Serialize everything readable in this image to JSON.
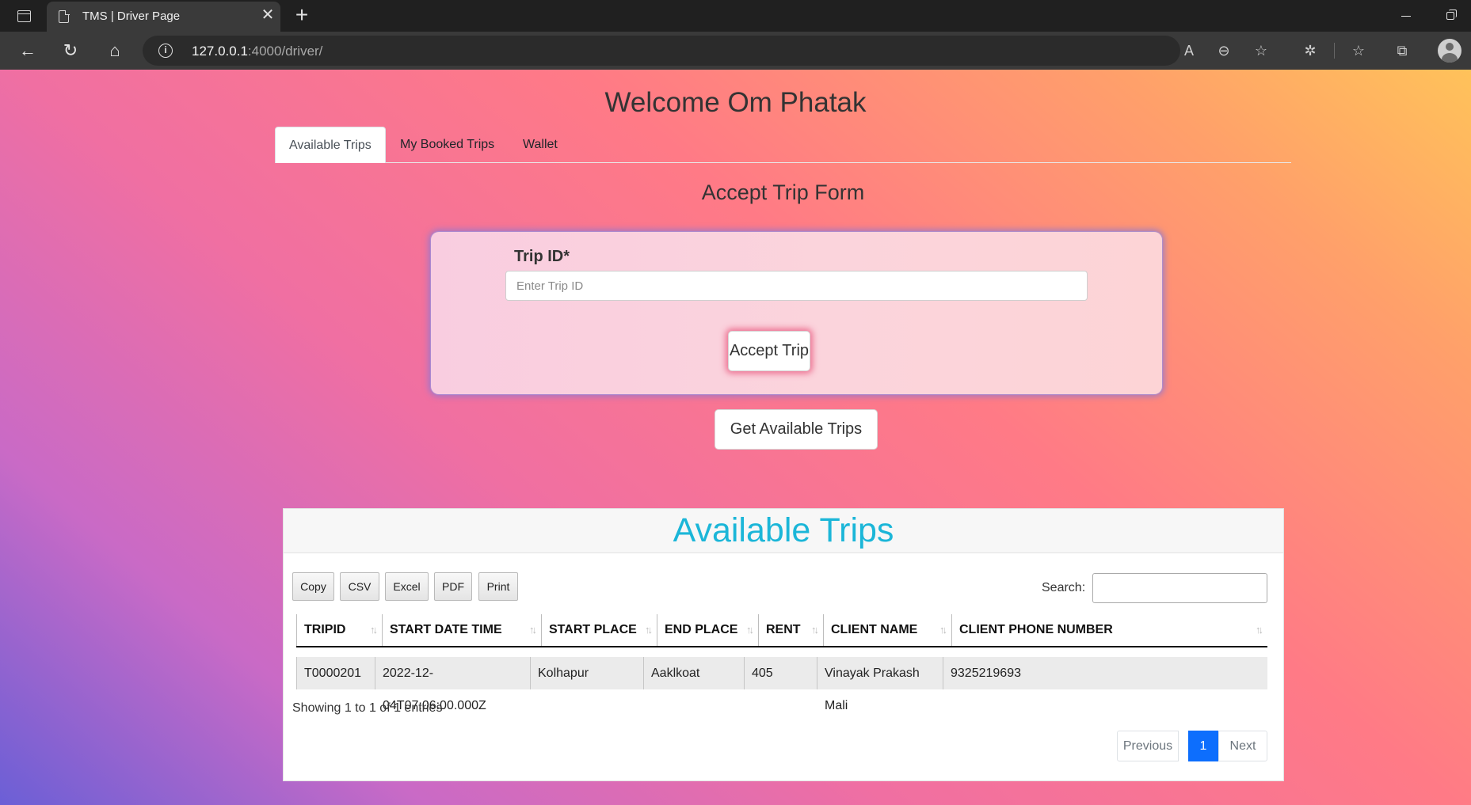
{
  "browser": {
    "tab_title": "TMS | Driver Page",
    "url_host": "127.0.0.1",
    "url_path": ":4000/driver/"
  },
  "page": {
    "welcome": "Welcome Om Phatak",
    "tabs": [
      {
        "label": "Available Trips",
        "active": true
      },
      {
        "label": "My Booked Trips",
        "active": false
      },
      {
        "label": "Wallet",
        "active": false
      }
    ],
    "form": {
      "heading": "Accept Trip Form",
      "trip_id_label": "Trip ID*",
      "trip_id_placeholder": "Enter Trip ID",
      "accept_label": "Accept Trip"
    },
    "get_trips_label": "Get Available Trips",
    "table_panel": {
      "title": "Available Trips",
      "buttons": [
        "Copy",
        "CSV",
        "Excel",
        "PDF",
        "Print"
      ],
      "search_label": "Search:",
      "columns": [
        "TRIPID",
        "START DATE TIME",
        "START PLACE",
        "END PLACE",
        "RENT",
        "CLIENT NAME",
        "CLIENT PHONE NUMBER"
      ],
      "rows": [
        [
          "T0000201",
          "2022-12-04T07:06:00.000Z",
          "Kolhapur",
          "Aaklkoat",
          "405",
          "Vinayak Prakash Mali",
          "9325219693"
        ]
      ],
      "info": "Showing 1 to 1 of 1 entries",
      "pagination": {
        "previous": "Previous",
        "current": "1",
        "next": "Next"
      }
    }
  },
  "colors": {
    "panel_title": "#1bb6d8",
    "pager_active": "#0d6efd"
  }
}
